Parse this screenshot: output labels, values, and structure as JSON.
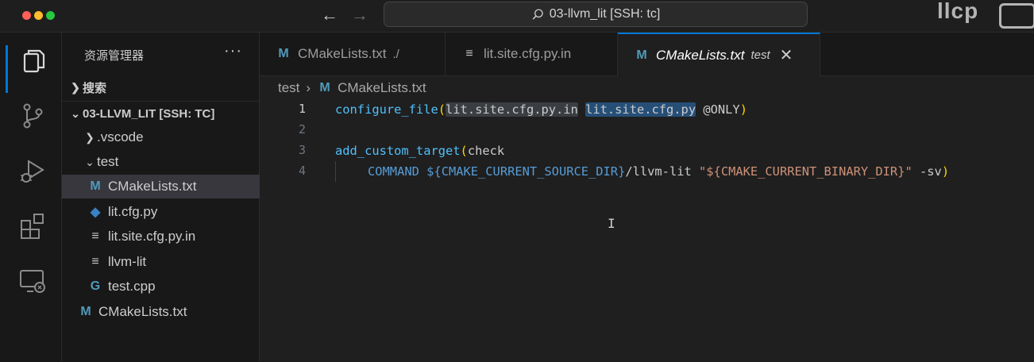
{
  "window": {
    "title": "03-llvm_lit [SSH: tc]",
    "watermark": "llcp"
  },
  "activity_bar": {
    "items": [
      "explorer-icon",
      "source-control-icon",
      "run-debug-icon",
      "extensions-icon",
      "remote-explorer-icon"
    ]
  },
  "sidebar": {
    "title": "资源管理器",
    "more": "···",
    "search_label": "搜索",
    "folder_label": "03-LLVM_LIT [SSH: TC]",
    "tree": [
      {
        "label": ".vscode"
      },
      {
        "label": "test"
      },
      {
        "label": "CMakeLists.txt"
      },
      {
        "label": "lit.cfg.py"
      },
      {
        "label": "lit.site.cfg.py.in"
      },
      {
        "label": "llvm-lit"
      },
      {
        "label": "test.cpp"
      },
      {
        "label": "CMakeLists.txt"
      }
    ]
  },
  "tabs": [
    {
      "label": "CMakeLists.txt",
      "desc": "./"
    },
    {
      "label": "lit.site.cfg.py.in",
      "desc": ""
    },
    {
      "label": "CMakeLists.txt",
      "desc": "test",
      "close": "✕"
    }
  ],
  "breadcrumb": {
    "folder": "test",
    "separator": "›",
    "file": "CMakeLists.txt"
  },
  "editor": {
    "line_numbers": [
      "1",
      "2",
      "3",
      "4"
    ],
    "line1": {
      "fn": "configure_file",
      "open": "(",
      "arg1": "lit.site.cfg.py.in",
      "space": " ",
      "arg2": "lit.site.cfg.py",
      "arg3": " @ONLY",
      "close": ")"
    },
    "line3": {
      "fn": "add_custom_target",
      "open": "(",
      "arg": "check"
    },
    "line4": {
      "kw": "COMMAND",
      "sp": " ",
      "var1": "${CMAKE_CURRENT_SOURCE_DIR}",
      "path": "/llvm-lit ",
      "str": "\"${CMAKE_CURRENT_BINARY_DIR}\"",
      "flag": " -sv",
      "close": ")"
    },
    "text_cursor": "I"
  },
  "colors": {
    "accent": "#0078d4",
    "function": "#4fc1ff",
    "variable": "#9cdcfe",
    "string": "#ce9178",
    "bracket": "#ffd700"
  }
}
